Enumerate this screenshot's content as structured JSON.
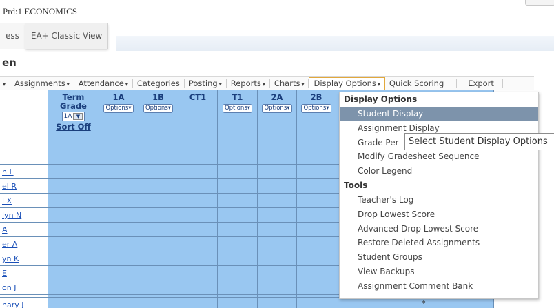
{
  "header": {
    "period": "Prd:1 ECONOMICS",
    "view_tabs": [
      {
        "label": "ess"
      },
      {
        "label": "EA+ Classic View"
      }
    ],
    "page_title": "en"
  },
  "menubar": {
    "items": [
      {
        "label": "",
        "caret": "▾"
      },
      {
        "label": "Assignments",
        "caret": "▾"
      },
      {
        "label": "Attendance",
        "caret": "▾"
      },
      {
        "label": "Categories",
        "caret": ""
      },
      {
        "label": "Posting",
        "caret": "▾"
      },
      {
        "label": "Reports",
        "caret": "▾"
      },
      {
        "label": "Charts",
        "caret": "▾"
      },
      {
        "label": "Display Options",
        "caret": "▾"
      },
      {
        "label": "Quick Scoring",
        "caret": ""
      },
      {
        "label": "Export",
        "caret": ""
      }
    ]
  },
  "grid": {
    "term_header": {
      "line1": "Term",
      "line2": "Grade",
      "selected": "1A",
      "sort": "Sort Off"
    },
    "columns": [
      {
        "code": "1A",
        "options": "Options"
      },
      {
        "code": "1B",
        "options": "Options"
      },
      {
        "code": "CT1",
        "options": ""
      },
      {
        "code": "T1",
        "options": "Options"
      },
      {
        "code": "2A",
        "options": "Options"
      },
      {
        "code": "2B",
        "options": "Options"
      }
    ],
    "students": [
      "n L",
      "el R",
      "l X",
      "lyn N",
      "A",
      "er A",
      "yn K",
      "E",
      "on J",
      "",
      "nary J"
    ],
    "asterisk": "*"
  },
  "dropdown": {
    "section_display": "Display Options",
    "display_items": [
      "Student Display",
      "Assignment Display",
      "Grade Per",
      "Modify Gradesheet Sequence",
      "Color Legend"
    ],
    "section_tools": "Tools",
    "tool_items": [
      "Teacher's Log",
      "Drop Lowest Score",
      "Advanced Drop Lowest Score",
      "Restore Deleted Assignments",
      "Student Groups",
      "View Backups",
      "Assignment Comment Bank"
    ]
  },
  "tooltip": "Select Student Display Options",
  "colors": {
    "grid_bg": "#99c7f1",
    "grid_lines": "#6a90b8",
    "link": "#1a50b8",
    "selected_item": "#7d93ab",
    "menu_highlight_border": "#e2a83c"
  }
}
